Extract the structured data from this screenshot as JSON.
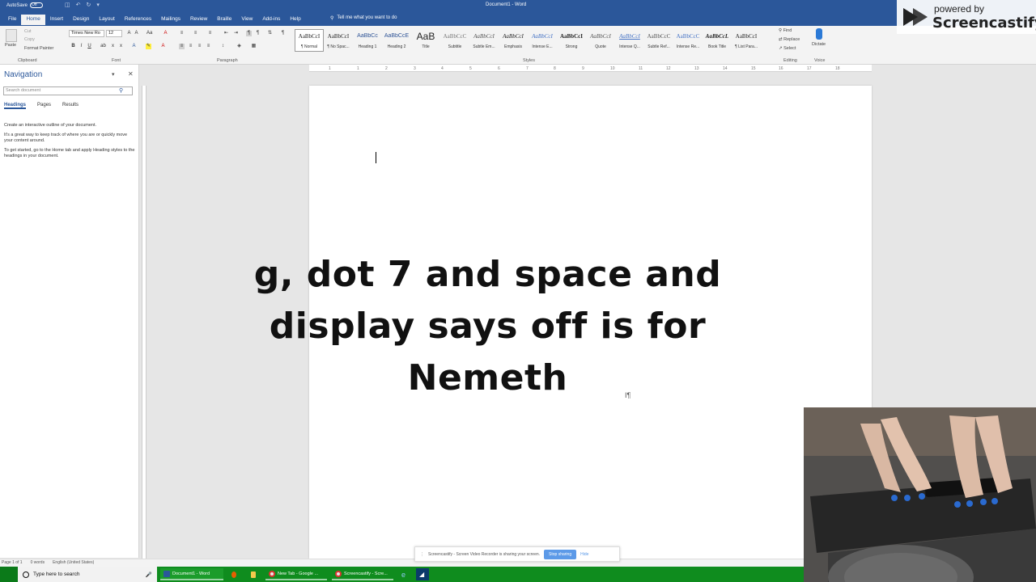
{
  "window": {
    "title": "Document1 - Word",
    "autosave_label": "AutoSave",
    "autosave_state": "Off"
  },
  "menu": {
    "tabs": [
      "File",
      "Home",
      "Insert",
      "Design",
      "Layout",
      "References",
      "Mailings",
      "Review",
      "Braille",
      "View",
      "Add-ins",
      "Help"
    ],
    "active": "Home",
    "tell_me": "Tell me what you want to do"
  },
  "ribbon": {
    "clipboard": {
      "label": "Clipboard",
      "paste": "Paste",
      "cut": "Cut",
      "copy": "Copy",
      "format_painter": "Format Painter"
    },
    "font": {
      "label": "Font",
      "name": "Times New Ro",
      "size": "12"
    },
    "paragraph": {
      "label": "Paragraph"
    },
    "styles": {
      "label": "Styles",
      "items": [
        {
          "preview": "AaBbCcI",
          "name": "¶ Normal",
          "selected": true
        },
        {
          "preview": "AaBbCcI",
          "name": "¶ No Spac..."
        },
        {
          "preview": "AaBbCc",
          "name": "Heading 1"
        },
        {
          "preview": "AaBbCcE",
          "name": "Heading 2"
        },
        {
          "preview": "AaB",
          "name": "Title"
        },
        {
          "preview": "AaBbCcC",
          "name": "Subtitle"
        },
        {
          "preview": "AaBbCcI",
          "name": "Subtle Em..."
        },
        {
          "preview": "AaBbCcI",
          "name": "Emphasis"
        },
        {
          "preview": "AaBbCcI",
          "name": "Intense E..."
        },
        {
          "preview": "AaBbCcI",
          "name": "Strong"
        },
        {
          "preview": "AaBbCcI",
          "name": "Quote"
        },
        {
          "preview": "AaBbCcI",
          "name": "Intense Q..."
        },
        {
          "preview": "AaBbCcC",
          "name": "Subtle Ref..."
        },
        {
          "preview": "AaBbCcC",
          "name": "Intense Re..."
        },
        {
          "preview": "AaBbCcL",
          "name": "Book Title"
        },
        {
          "preview": "AaBbCcI",
          "name": "¶ List Para..."
        }
      ]
    },
    "editing": {
      "label": "Editing",
      "find": "Find",
      "replace": "Replace",
      "select": "Select"
    },
    "voice": {
      "label": "Voice",
      "dictate": "Dictate"
    }
  },
  "ruler": {
    "numbers": [
      "1",
      "1",
      "2",
      "3",
      "4",
      "5",
      "6",
      "7",
      "8",
      "9",
      "10",
      "11",
      "12",
      "13",
      "14",
      "15",
      "16",
      "17",
      "18"
    ]
  },
  "navigation": {
    "title": "Navigation",
    "search_placeholder": "Search document",
    "tabs": [
      "Headings",
      "Pages",
      "Results"
    ],
    "help": [
      "Create an interactive outline of your document.",
      "It's a great way to keep track of where you are or quickly move your content around.",
      "To get started, go to the Home tab and apply Heading styles to the headings in your document."
    ]
  },
  "caption": "g, dot 7 and space and display says off is for Nemeth",
  "status": {
    "page": "Page 1 of 1",
    "words": "0 words",
    "language": "English (United States)"
  },
  "share_bar": {
    "message": "Screencastify - Screen Video Recorder is sharing your screen.",
    "stop": "Stop sharing",
    "hide": "Hide"
  },
  "watermark": {
    "powered_by": "powered by",
    "brand": "Screencastify"
  },
  "taskbar": {
    "search_placeholder": "Type here to search",
    "items": [
      "Document1 - Word",
      "New Tab - Google ...",
      "Screencastify - Scre..."
    ]
  },
  "colors": {
    "word_blue": "#2b579a",
    "taskbar_green": "#0f8c1e",
    "share_blue": "#5c9ae8"
  }
}
